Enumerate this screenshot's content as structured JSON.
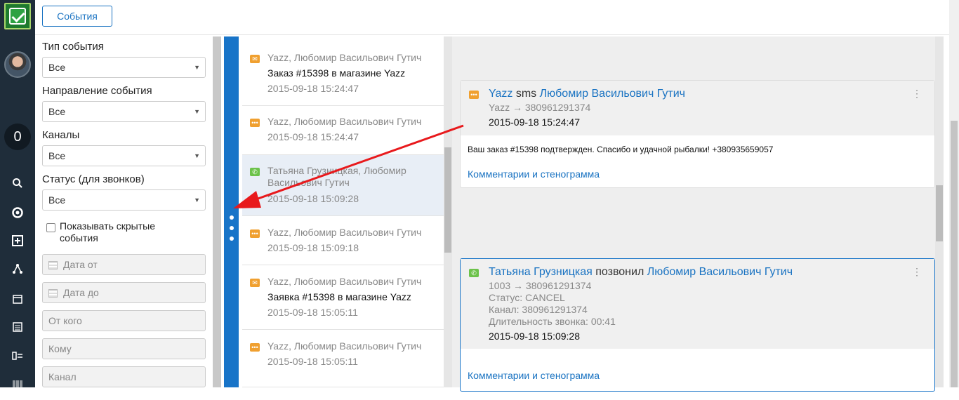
{
  "header": {
    "events_button": "События"
  },
  "rail": {
    "counter": "0"
  },
  "filters": {
    "event_type_label": "Тип события",
    "event_type_value": "Все",
    "direction_label": "Направление события",
    "direction_value": "Все",
    "channels_label": "Каналы",
    "channels_value": "Все",
    "status_label": "Статус (для звонков)",
    "status_value": "Все",
    "show_hidden_label": "Показывать скрытые события",
    "date_from_placeholder": "Дата от",
    "date_to_placeholder": "Дата до",
    "from_placeholder": "От кого",
    "to_placeholder": "Кому",
    "channel_placeholder": "Канал"
  },
  "events": [
    {
      "type": "email",
      "from": "Yazz, Любомир Васильович Гутич",
      "subject": "Заказ #15398 в магазине Yazz",
      "time": "2015-09-18 15:24:47"
    },
    {
      "type": "sms",
      "from": "Yazz, Любомир Васильович Гутич",
      "subject": "",
      "time": "2015-09-18 15:24:47"
    },
    {
      "type": "call",
      "from": "Татьяна Грузницкая, Любомир Васильович Гутич",
      "subject": "",
      "time": "2015-09-18 15:09:28"
    },
    {
      "type": "sms",
      "from": "Yazz, Любомир Васильович Гутич",
      "subject": "",
      "time": "2015-09-18 15:09:18"
    },
    {
      "type": "email",
      "from": "Yazz, Любомир Васильович Гутич",
      "subject": "Заявка #15398 в магазине Yazz",
      "time": "2015-09-18 15:05:11"
    },
    {
      "type": "sms",
      "from": "Yazz, Любомир Васильович Гутич",
      "subject": "",
      "time": "2015-09-18 15:05:11"
    }
  ],
  "card_sms": {
    "sender": "Yazz",
    "action": "sms",
    "recipient": "Любомир Васильович Гутич",
    "route": "Yazz → 380961291374",
    "time": "2015-09-18 15:24:47",
    "body": "Ваш заказ #15398 подтвержден. Спасибо и удачной рыбалки! +380935659057",
    "comments_link": "Комментарии и стенограмма"
  },
  "card_call": {
    "caller": "Татьяна Грузницкая",
    "action": "позвонил",
    "recipient": "Любомир Васильович Гутич",
    "route": "1003 → 380961291374",
    "status": "Статус: CANCEL",
    "channel": "Канал: 380961291374",
    "duration": "Длительность звонка: 00:41",
    "time": "2015-09-18 15:09:28",
    "comments_link": "Комментарии и стенограмма"
  },
  "colors": {
    "accent": "#1874c8",
    "sidebar": "#1f2d3a",
    "email_icon": "#f0a030",
    "call_icon": "#6cc24a",
    "arrow": "#e8191c"
  }
}
